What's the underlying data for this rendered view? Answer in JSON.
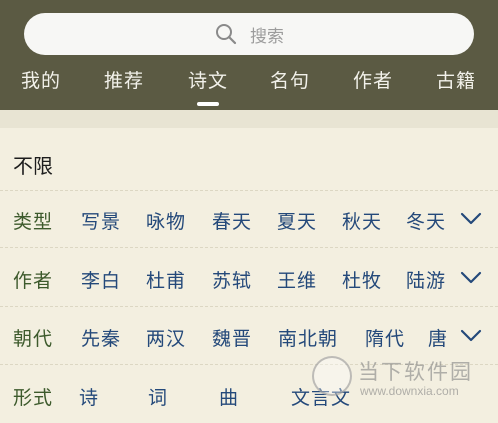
{
  "search": {
    "placeholder": "搜索",
    "icon": "search-icon"
  },
  "tabs": [
    "我的",
    "推荐",
    "诗文",
    "名句",
    "作者",
    "古籍"
  ],
  "active_tab": "诗文",
  "filter": {
    "unlimited": "不限",
    "rows": [
      {
        "label": "类型",
        "options": [
          "写景",
          "咏物",
          "春天",
          "夏天",
          "秋天",
          "冬天"
        ],
        "expandable": true
      },
      {
        "label": "作者",
        "options": [
          "李白",
          "杜甫",
          "苏轼",
          "王维",
          "杜牧",
          "陆游"
        ],
        "expandable": true
      },
      {
        "label": "朝代",
        "options": [
          "先秦",
          "两汉",
          "魏晋",
          "南北朝",
          "隋代",
          "唐"
        ],
        "expandable": true
      },
      {
        "label": "形式",
        "options": [
          "诗",
          "词",
          "曲",
          "文言文"
        ],
        "expandable": false
      }
    ]
  },
  "watermark": {
    "title": "当下软件园",
    "url": "www.downxia.com"
  },
  "colors": {
    "header": "#5b5a43",
    "background": "#f3efe0",
    "label": "#3d5a2c",
    "option": "#24497a"
  }
}
